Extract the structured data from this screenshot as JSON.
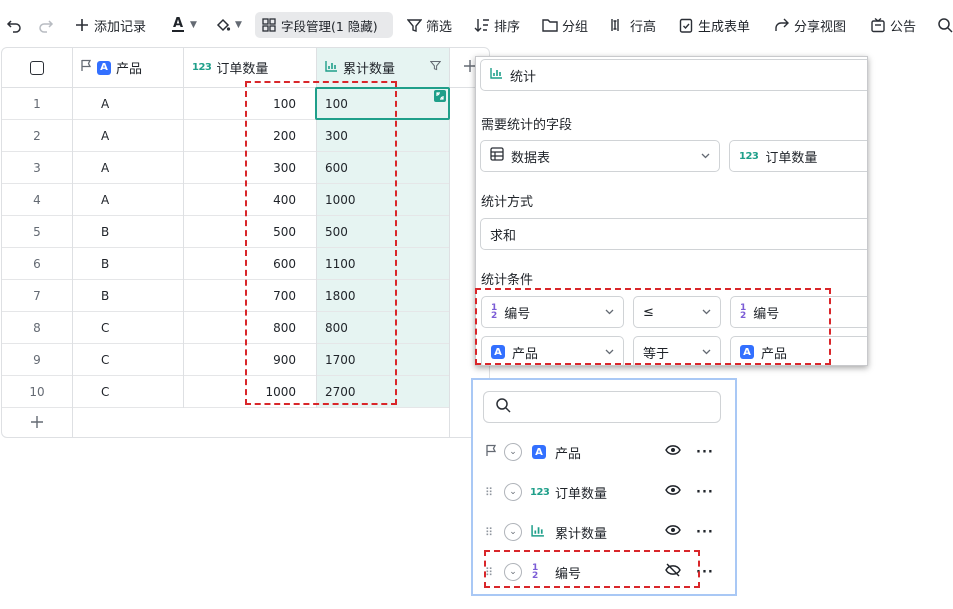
{
  "toolbar": {
    "add_record": "添加记录",
    "text_color_glyph": "A",
    "field_manage": "字段管理(1 隐藏)",
    "filter": "筛选",
    "sort": "排序",
    "group": "分组",
    "row_height": "行高",
    "generate_form": "生成表单",
    "share_view": "分享视图",
    "announcement": "公告"
  },
  "grid": {
    "columns": {
      "product": "产品",
      "order_qty": "订单数量",
      "cumulative_qty": "累计数量",
      "num_icon": "123"
    },
    "rows": [
      {
        "id": "1",
        "product": "A",
        "qty": "100",
        "cum": "100"
      },
      {
        "id": "2",
        "product": "A",
        "qty": "200",
        "cum": "300"
      },
      {
        "id": "3",
        "product": "A",
        "qty": "300",
        "cum": "600"
      },
      {
        "id": "4",
        "product": "A",
        "qty": "400",
        "cum": "1000"
      },
      {
        "id": "5",
        "product": "B",
        "qty": "500",
        "cum": "500"
      },
      {
        "id": "6",
        "product": "B",
        "qty": "600",
        "cum": "1100"
      },
      {
        "id": "7",
        "product": "B",
        "qty": "700",
        "cum": "1800"
      },
      {
        "id": "8",
        "product": "C",
        "qty": "800",
        "cum": "800"
      },
      {
        "id": "9",
        "product": "C",
        "qty": "900",
        "cum": "1700"
      },
      {
        "id": "10",
        "product": "C",
        "qty": "1000",
        "cum": "2700"
      }
    ]
  },
  "stats_panel": {
    "type_value": "统计",
    "fields_label": "需要统计的字段",
    "table_value": "数据表",
    "field_value": "订单数量",
    "method_label": "统计方式",
    "method_value": "求和",
    "condition_label": "统计条件",
    "conditions": [
      {
        "field": "编号",
        "operator": "≤",
        "value": "编号"
      },
      {
        "field": "产品",
        "operator": "等于",
        "value": "产品"
      }
    ]
  },
  "field_panel": {
    "search_placeholder": "",
    "fields": [
      {
        "name": "产品",
        "visible": true
      },
      {
        "name": "订单数量",
        "visible": true
      },
      {
        "name": "累计数量",
        "visible": true
      },
      {
        "name": "编号",
        "visible": false
      }
    ]
  },
  "colors": {
    "accent_teal": "#1f9f8a",
    "blue_badge": "#3370ff",
    "annotation_red": "#d9262a",
    "selected_column_bg": "#e6f4f2"
  }
}
